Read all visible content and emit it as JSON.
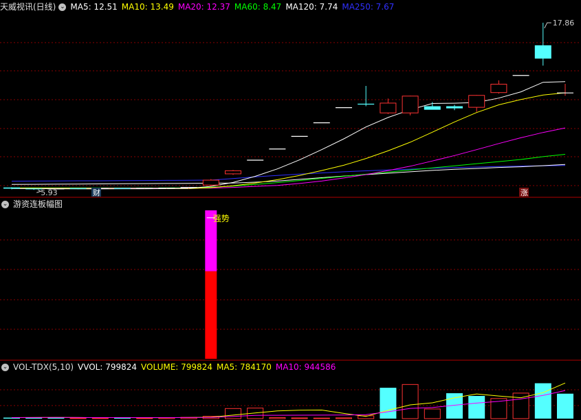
{
  "main_panel": {
    "stock_title": "天威视讯(日线)",
    "ma_legend": [
      {
        "label": "MA5: 12.51",
        "color": "#ffffff"
      },
      {
        "label": "MA10: 13.49",
        "color": "#ffff00"
      },
      {
        "label": "MA20: 12.37",
        "color": "#ff00ff"
      },
      {
        "label": "MA60: 8.47",
        "color": "#00ff00"
      },
      {
        "label": "MA120: 7.74",
        "color": "#ffffff"
      },
      {
        "label": "MA250: 7.67",
        "color": "#3030ff"
      }
    ],
    "high_annotation": "17.86",
    "low_annotation": "5.93",
    "marker_left": "财",
    "marker_right": "涨"
  },
  "indicator_panel": {
    "title": "游资连板幅图",
    "annotation": "强势"
  },
  "volume_panel": {
    "title": "VOL-TDX(5,10)",
    "legend": [
      {
        "label": "VVOL: 799824",
        "color": "#ffffff"
      },
      {
        "label": "VOLUME: 799824",
        "color": "#ffff00"
      },
      {
        "label": "MA5: 784170",
        "color": "#ffff00"
      },
      {
        "label": "MA10: 944586",
        "color": "#ff00ff"
      }
    ]
  },
  "colors": {
    "up": "#ff3232",
    "down": "#54ffff",
    "grid": "#8b0000",
    "separator": "#b00000"
  },
  "chart_data": [
    {
      "type": "candlestick",
      "title": "天威视讯(日线)",
      "ylim": [
        5.5,
        18.6
      ],
      "x": [
        1,
        2,
        3,
        4,
        5,
        6,
        7,
        8,
        9,
        10,
        11,
        12,
        13,
        14,
        15,
        16,
        17,
        18,
        19,
        20,
        21,
        22,
        23,
        24,
        25,
        26
      ],
      "candles": [
        {
          "o": 6.1,
          "h": 6.12,
          "l": 5.97,
          "c": 6.02
        },
        {
          "o": 6.0,
          "h": 6.03,
          "l": 5.93,
          "c": 5.96
        },
        {
          "o": 6.0,
          "h": 6.04,
          "l": 5.97,
          "c": 6.0
        },
        {
          "o": 6.02,
          "h": 6.04,
          "l": 5.98,
          "c": 6.0
        },
        {
          "o": 6.0,
          "h": 6.05,
          "l": 5.98,
          "c": 6.02
        },
        {
          "o": 6.02,
          "h": 6.05,
          "l": 5.99,
          "c": 6.01
        },
        {
          "o": 6.01,
          "h": 6.06,
          "l": 5.99,
          "c": 6.03
        },
        {
          "o": 6.03,
          "h": 6.08,
          "l": 6.0,
          "c": 6.05
        },
        {
          "o": 6.05,
          "h": 6.12,
          "l": 6.02,
          "c": 6.1
        },
        {
          "o": 6.25,
          "h": 6.7,
          "l": 6.2,
          "c": 6.65
        },
        {
          "o": 7.05,
          "h": 7.35,
          "l": 7.0,
          "c": 7.32
        },
        {
          "o": 8.05,
          "h": 8.05,
          "l": 8.05,
          "c": 8.05
        },
        {
          "o": 8.85,
          "h": 8.85,
          "l": 8.85,
          "c": 8.85
        },
        {
          "o": 9.75,
          "h": 9.75,
          "l": 9.75,
          "c": 9.75
        },
        {
          "o": 10.72,
          "h": 10.72,
          "l": 10.72,
          "c": 10.72
        },
        {
          "o": 11.8,
          "h": 11.8,
          "l": 11.8,
          "c": 11.8
        },
        {
          "o": 12.05,
          "h": 13.35,
          "l": 11.9,
          "c": 12.0
        },
        {
          "o": 11.4,
          "h": 12.45,
          "l": 11.35,
          "c": 12.15
        },
        {
          "o": 11.4,
          "h": 12.65,
          "l": 11.25,
          "c": 12.65
        },
        {
          "o": 11.9,
          "h": 12.2,
          "l": 11.8,
          "c": 11.65
        },
        {
          "o": 11.9,
          "h": 12.0,
          "l": 11.62,
          "c": 11.75
        },
        {
          "o": 11.8,
          "h": 12.7,
          "l": 11.5,
          "c": 12.7
        },
        {
          "o": 12.85,
          "h": 13.75,
          "l": 12.8,
          "c": 13.5
        },
        {
          "o": 14.1,
          "h": 14.1,
          "l": 14.1,
          "c": 14.1
        },
        {
          "o": 16.25,
          "h": 17.86,
          "l": 14.8,
          "c": 15.3
        },
        {
          "o": 12.85,
          "h": 13.5,
          "l": 12.65,
          "c": 12.85
        }
      ],
      "series": [
        {
          "name": "MA5",
          "color": "#ffffff",
          "values": [
            6.03,
            6.02,
            6.01,
            6.0,
            6.0,
            6.01,
            6.01,
            6.02,
            6.04,
            6.18,
            6.46,
            6.9,
            7.43,
            8.07,
            8.8,
            9.57,
            10.42,
            11.1,
            11.65,
            12.1,
            12.12,
            12.17,
            12.48,
            12.93,
            13.61,
            13.66
          ]
        },
        {
          "name": "MA10",
          "color": "#ffff00",
          "values": [
            6.05,
            6.05,
            6.04,
            6.04,
            6.03,
            6.02,
            6.02,
            6.02,
            6.02,
            6.09,
            6.22,
            6.42,
            6.66,
            6.96,
            7.31,
            7.69,
            8.17,
            8.72,
            9.33,
            10.05,
            10.78,
            11.45,
            12.0,
            12.38,
            12.7,
            12.86
          ]
        },
        {
          "name": "MA20",
          "color": "#ff00ff",
          "values": [
            6.05,
            6.05,
            6.05,
            6.05,
            6.05,
            6.05,
            6.05,
            6.05,
            6.05,
            6.06,
            6.11,
            6.18,
            6.25,
            6.39,
            6.56,
            6.78,
            7.02,
            7.31,
            7.62,
            7.99,
            8.38,
            8.8,
            9.24,
            9.65,
            10.03,
            10.35
          ]
        },
        {
          "name": "MA60",
          "color": "#00ff00",
          "values": [
            6.08,
            6.08,
            6.08,
            6.08,
            6.08,
            6.08,
            6.08,
            6.08,
            6.09,
            6.12,
            6.2,
            6.32,
            6.45,
            6.6,
            6.75,
            6.9,
            7.05,
            7.2,
            7.35,
            7.5,
            7.65,
            7.8,
            7.95,
            8.1,
            8.3,
            8.47
          ]
        },
        {
          "name": "MA120",
          "color": "#ffffff",
          "values": [
            6.32,
            6.33,
            6.34,
            6.35,
            6.36,
            6.37,
            6.38,
            6.39,
            6.4,
            6.41,
            6.42,
            6.48,
            6.56,
            6.68,
            6.8,
            6.92,
            7.02,
            7.12,
            7.22,
            7.32,
            7.4,
            7.46,
            7.53,
            7.58,
            7.66,
            7.74
          ]
        },
        {
          "name": "MA250",
          "color": "#3030ff",
          "values": [
            6.55,
            6.56,
            6.57,
            6.58,
            6.58,
            6.59,
            6.6,
            6.61,
            6.62,
            6.63,
            6.74,
            6.86,
            6.96,
            7.06,
            7.14,
            7.22,
            7.29,
            7.35,
            7.41,
            7.47,
            7.52,
            7.56,
            7.6,
            7.63,
            7.65,
            7.67
          ]
        }
      ]
    },
    {
      "type": "bar",
      "title": "游资连板幅图",
      "ylim": [
        0,
        10
      ],
      "segments": [
        {
          "index": 10,
          "from": 0,
          "to": 5.9,
          "color": "#ff0000"
        },
        {
          "index": 10,
          "from": 5.9,
          "to": 10,
          "color": "#ff00ff"
        }
      ],
      "annotation": "强势"
    },
    {
      "type": "bar",
      "title": "VOL-TDX(5,10)",
      "ylim": [
        0,
        1000000
      ],
      "values": [
        22000,
        26000,
        30000,
        18000,
        20000,
        16000,
        22000,
        28000,
        35000,
        58000,
        230000,
        240000,
        30000,
        24000,
        20000,
        25000,
        70000,
        680000,
        760000,
        220000,
        560000,
        500000,
        450000,
        570000,
        780000,
        550000
      ],
      "directions": [
        "down",
        "down",
        "down",
        "up",
        "up",
        "down",
        "up",
        "up",
        "up",
        "up",
        "up",
        "up",
        "up",
        "up",
        "up",
        "up",
        "up",
        "down",
        "up",
        "up",
        "down",
        "down",
        "up",
        "up",
        "down",
        "down"
      ],
      "series": [
        {
          "name": "MA5",
          "color": "#ffff00",
          "values": [
            22000,
            24000,
            26000,
            24000,
            23000,
            22000,
            21000,
            21000,
            24000,
            32000,
            77000,
            125000,
            171000,
            186000,
            190000,
            115000,
            49000,
            184000,
            303000,
            349000,
            458000,
            544000,
            498000,
            460000,
            572000,
            784170
          ]
        },
        {
          "name": "MA10",
          "color": "#ff00ff",
          "values": [
            22000,
            24000,
            26000,
            24000,
            23000,
            22000,
            22000,
            23000,
            24000,
            28000,
            49000,
            73000,
            74000,
            75000,
            77000,
            79000,
            87000,
            152000,
            225000,
            244000,
            296000,
            342000,
            380000,
            434000,
            510000,
            620000
          ]
        }
      ]
    }
  ]
}
